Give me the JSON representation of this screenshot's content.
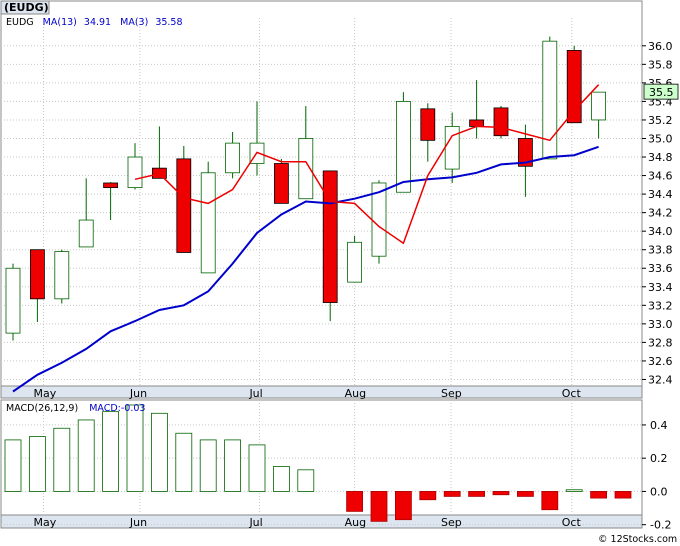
{
  "chart_data": [
    {
      "type": "candlestick",
      "title": "(EUDG)",
      "legend": [
        {
          "label": "EUDG",
          "color": "#000000"
        },
        {
          "label": "MA(13)",
          "value": "34.91",
          "color": "#0000cc"
        },
        {
          "label": "MA(3)",
          "value": "35.58",
          "color": "#0000cc"
        }
      ],
      "ylim": [
        32.2,
        36.3
      ],
      "yticks": [
        "36.0",
        "35.6",
        "35.2",
        "34.8",
        "34.4",
        "34.0",
        "33.6",
        "33.2",
        "32.8",
        "32.4",
        "35.8",
        "35.4",
        "35.0",
        "34.6",
        "34.2",
        "33.8",
        "33.4",
        "33.0",
        "32.6"
      ],
      "months": [
        "May",
        "Jun",
        "Jul",
        "Aug",
        "Sep",
        "Oct"
      ],
      "month_index": [
        1.25,
        5.2,
        10.1,
        14.0,
        17.95,
        22.9
      ],
      "last_price": "35.5",
      "colors": {
        "up_fill": "#ffffff",
        "up_stroke": "#006400",
        "down_fill": "#ee0000",
        "down_stroke": "#000000",
        "wick": "#006400",
        "ma3": "#ee0000",
        "ma13": "#0000cc",
        "axis_bg": "#dde6f0",
        "last_bg": "#ccffcc"
      },
      "candles": [
        {
          "o": 32.9,
          "c": 33.6,
          "h": 33.65,
          "l": 32.82
        },
        {
          "o": 33.8,
          "c": 33.27,
          "h": 33.8,
          "l": 33.02
        },
        {
          "o": 33.27,
          "c": 33.78,
          "h": 33.8,
          "l": 33.22
        },
        {
          "o": 33.83,
          "c": 34.12,
          "h": 34.57,
          "l": 33.83
        },
        {
          "o": 34.52,
          "c": 34.47,
          "h": 34.53,
          "l": 34.12
        },
        {
          "o": 34.47,
          "c": 34.8,
          "h": 34.95,
          "l": 34.45
        },
        {
          "o": 34.68,
          "c": 34.57,
          "h": 35.13,
          "l": 34.57
        },
        {
          "o": 34.78,
          "c": 33.77,
          "h": 34.92,
          "l": 33.77
        },
        {
          "o": 33.55,
          "c": 34.63,
          "h": 34.75,
          "l": 33.55
        },
        {
          "o": 34.63,
          "c": 34.95,
          "h": 35.07,
          "l": 34.57
        },
        {
          "o": 34.73,
          "c": 34.95,
          "h": 35.4,
          "l": 34.6
        },
        {
          "o": 34.73,
          "c": 34.3,
          "h": 34.78,
          "l": 34.3
        },
        {
          "o": 34.35,
          "c": 35.0,
          "h": 35.35,
          "l": 34.35
        },
        {
          "o": 34.65,
          "c": 33.23,
          "h": 34.65,
          "l": 33.03
        },
        {
          "o": 33.45,
          "c": 33.88,
          "h": 33.95,
          "l": 33.45
        },
        {
          "o": 33.73,
          "c": 34.52,
          "h": 34.55,
          "l": 33.65
        },
        {
          "o": 34.42,
          "c": 35.4,
          "h": 35.5,
          "l": 34.42
        },
        {
          "o": 35.32,
          "c": 34.98,
          "h": 35.38,
          "l": 34.75
        },
        {
          "o": 34.67,
          "c": 35.13,
          "h": 35.28,
          "l": 34.52
        },
        {
          "o": 35.2,
          "c": 35.13,
          "h": 35.63,
          "l": 35.0
        },
        {
          "o": 35.33,
          "c": 35.03,
          "h": 35.35,
          "l": 35.0
        },
        {
          "o": 35.0,
          "c": 34.7,
          "h": 35.15,
          "l": 34.37
        },
        {
          "o": 34.78,
          "c": 36.05,
          "h": 36.1,
          "l": 34.78
        },
        {
          "o": 35.95,
          "c": 35.17,
          "h": 36.0,
          "l": 35.17
        },
        {
          "o": 35.2,
          "c": 35.5,
          "h": 35.5,
          "l": 35.0
        }
      ],
      "ma3": [
        null,
        null,
        null,
        null,
        null,
        34.56,
        34.62,
        34.36,
        34.3,
        34.45,
        34.85,
        34.75,
        34.75,
        34.32,
        34.3,
        34.05,
        33.87,
        34.6,
        35.03,
        35.13,
        35.12,
        35.05,
        34.98,
        35.3,
        35.58
      ],
      "ma13": [
        32.27,
        32.45,
        32.58,
        32.73,
        32.92,
        33.03,
        33.15,
        33.2,
        33.35,
        33.65,
        33.98,
        34.18,
        34.32,
        34.3,
        34.35,
        34.42,
        34.53,
        34.56,
        34.58,
        34.63,
        34.72,
        34.74,
        34.8,
        34.82,
        34.91
      ]
    },
    {
      "type": "bar",
      "title": "MACD(26,12,9)",
      "legend": [
        {
          "label": "MACD",
          "value": "-0.03",
          "color": "#0000cc"
        }
      ],
      "ylim": [
        -0.22,
        0.55
      ],
      "yticks": [
        "0.4",
        "0.2",
        "0.0",
        "-0.2"
      ],
      "months": [
        "May",
        "Jun",
        "Jul",
        "Aug",
        "Sep",
        "Oct"
      ],
      "values": [
        0.31,
        0.33,
        0.38,
        0.43,
        0.48,
        0.52,
        0.47,
        0.35,
        0.31,
        0.31,
        0.28,
        0.15,
        0.13,
        null,
        -0.12,
        -0.18,
        -0.17,
        -0.05,
        -0.03,
        -0.03,
        -0.02,
        -0.03,
        -0.11,
        0.01,
        -0.04,
        -0.04
      ]
    }
  ],
  "watermark": "© 12Stocks.com"
}
